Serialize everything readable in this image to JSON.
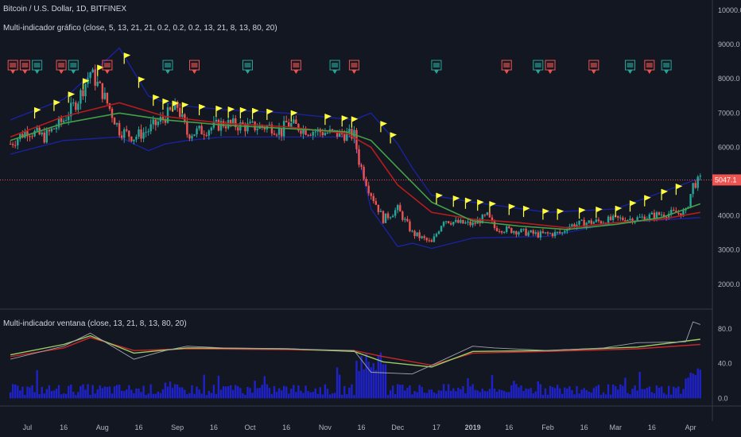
{
  "header": {
    "symbol": "Bitcoin / U.S. Dollar, 1D, BITFINEX",
    "main_indicator": "Multi-indicador gráfico (close, 5, 13, 21, 21, 0.2, 0.2, 0.2, 13, 21, 8, 13, 80, 20)",
    "sub_indicator": "Multi-indicador ventana (close, 13, 21, 8, 13, 80, 20)"
  },
  "colors": {
    "background": "#131722",
    "up": "#26a69a",
    "down": "#ef5350",
    "ma_red": "#b71c1c",
    "ma_green": "#43a047",
    "band": "#1a23a8",
    "flag": "#ffff3b",
    "price_line": "#ef5350",
    "volume": "#1e22c8",
    "osc_white": "#a0a3ab",
    "osc_green": "#9ccc65",
    "osc_red": "#c62828"
  },
  "price_label": "5047.1",
  "chart_data": {
    "type": "candlestick",
    "price_axis": {
      "ticks": [
        "10000.0",
        "9000.0",
        "8000.0",
        "7000.0",
        "6000.0",
        "5000.0",
        "4000.0",
        "3000.0",
        "2000.0"
      ],
      "tick_values": [
        10000,
        9000,
        8000,
        7000,
        6000,
        5000,
        4000,
        3000,
        2000
      ],
      "range": [
        1300,
        10300
      ]
    },
    "osc_axis": {
      "ticks": [
        "80.0",
        "40.0",
        "0.0"
      ],
      "tick_values": [
        80,
        40,
        0
      ],
      "range": [
        -8,
        100
      ]
    },
    "x_axis": {
      "labels": [
        "Jul",
        "16",
        "Aug",
        "16",
        "Sep",
        "16",
        "Oct",
        "16",
        "Nov",
        "16",
        "Dec",
        "17",
        "2019",
        "16",
        "Feb",
        "16",
        "Mar",
        "16",
        "Apr"
      ],
      "label_dates": [
        "2018-07-01",
        "2018-07-16",
        "2018-08-01",
        "2018-08-16",
        "2018-09-01",
        "2018-09-16",
        "2018-10-01",
        "2018-10-16",
        "2018-11-01",
        "2018-11-16",
        "2018-12-01",
        "2018-12-17",
        "2019-01-01",
        "2019-01-16",
        "2019-02-01",
        "2019-02-16",
        "2019-03-01",
        "2019-03-16",
        "2019-04-01"
      ]
    },
    "series": [
      {
        "name": "close",
        "dates": [
          "2018-06-24",
          "2018-07-01",
          "2018-07-08",
          "2018-07-16",
          "2018-07-22",
          "2018-07-27",
          "2018-08-01",
          "2018-08-08",
          "2018-08-14",
          "2018-08-20",
          "2018-08-27",
          "2018-09-01",
          "2018-09-05",
          "2018-09-12",
          "2018-09-20",
          "2018-09-30",
          "2018-10-10",
          "2018-10-14",
          "2018-10-16",
          "2018-10-25",
          "2018-11-05",
          "2018-11-13",
          "2018-11-15",
          "2018-11-19",
          "2018-11-21",
          "2018-11-25",
          "2018-12-01",
          "2018-12-07",
          "2018-12-15",
          "2018-12-20",
          "2018-12-25",
          "2019-01-01",
          "2019-01-07",
          "2019-01-10",
          "2019-01-20",
          "2019-01-28",
          "2019-02-07",
          "2019-02-09",
          "2019-02-17",
          "2019-02-24",
          "2019-03-01",
          "2019-03-10",
          "2019-03-20",
          "2019-03-30",
          "2019-04-02",
          "2019-04-05"
        ],
        "values": [
          6100,
          6500,
          6300,
          6800,
          7400,
          8200,
          7600,
          6500,
          6300,
          6500,
          6900,
          7200,
          6400,
          6500,
          6700,
          6600,
          6600,
          6450,
          6700,
          6500,
          6400,
          6350,
          5600,
          4800,
          4500,
          3900,
          4200,
          3500,
          3200,
          3900,
          3800,
          3750,
          4000,
          3650,
          3550,
          3450,
          3500,
          3700,
          3800,
          3850,
          3900,
          3920,
          4050,
          4100,
          4900,
          5047
        ]
      },
      {
        "name": "ma_red",
        "dates": [
          "2018-06-24",
          "2018-07-16",
          "2018-08-08",
          "2018-08-27",
          "2018-09-20",
          "2018-10-16",
          "2018-11-10",
          "2018-11-20",
          "2018-12-01",
          "2018-12-15",
          "2019-01-01",
          "2019-01-20",
          "2019-02-09",
          "2019-03-01",
          "2019-03-20",
          "2019-04-05"
        ],
        "values": [
          6300,
          6900,
          7300,
          6900,
          6700,
          6600,
          6400,
          6000,
          4900,
          4100,
          3900,
          3800,
          3650,
          3800,
          3900,
          4100
        ]
      },
      {
        "name": "ma_green",
        "dates": [
          "2018-06-24",
          "2018-07-16",
          "2018-08-08",
          "2018-08-27",
          "2018-09-20",
          "2018-10-16",
          "2018-11-10",
          "2018-11-20",
          "2018-12-01",
          "2018-12-15",
          "2019-01-01",
          "2019-01-20",
          "2019-02-09",
          "2019-03-01",
          "2019-03-20",
          "2019-04-05"
        ],
        "values": [
          6200,
          6700,
          7000,
          6800,
          6650,
          6550,
          6450,
          6200,
          5400,
          4400,
          3850,
          3700,
          3600,
          3750,
          3950,
          4350
        ]
      },
      {
        "name": "band_upper",
        "dates": [
          "2018-06-24",
          "2018-07-16",
          "2018-08-08",
          "2018-08-20",
          "2018-08-27",
          "2018-09-05",
          "2018-09-20",
          "2018-10-16",
          "2018-11-13",
          "2018-11-20",
          "2018-12-01",
          "2018-12-07",
          "2018-12-15",
          "2019-01-01",
          "2019-02-01",
          "2019-03-01",
          "2019-04-05"
        ],
        "values": [
          6800,
          7400,
          8900,
          7500,
          7300,
          7200,
          7100,
          7000,
          6800,
          7000,
          6100,
          5400,
          4600,
          4400,
          4100,
          4200,
          5100
        ]
      },
      {
        "name": "band_lower",
        "dates": [
          "2018-06-24",
          "2018-07-16",
          "2018-08-08",
          "2018-08-20",
          "2018-08-27",
          "2018-09-05",
          "2018-09-20",
          "2018-10-16",
          "2018-11-13",
          "2018-11-20",
          "2018-12-01",
          "2018-12-07",
          "2018-12-15",
          "2019-01-01",
          "2019-02-01",
          "2019-03-01",
          "2019-04-05"
        ],
        "values": [
          5800,
          6200,
          6300,
          5900,
          6100,
          6200,
          6300,
          6300,
          6300,
          4200,
          3100,
          3200,
          3050,
          3350,
          3400,
          3800,
          3950
        ]
      },
      {
        "name": "osc_white",
        "dates": [
          "2018-06-24",
          "2018-07-16",
          "2018-07-27",
          "2018-08-14",
          "2018-08-27",
          "2018-09-05",
          "2018-09-20",
          "2018-10-16",
          "2018-11-13",
          "2018-11-20",
          "2018-12-07",
          "2018-12-15",
          "2019-01-01",
          "2019-01-10",
          "2019-02-01",
          "2019-02-24",
          "2019-03-10",
          "2019-03-30",
          "2019-04-02",
          "2019-04-05"
        ],
        "values": [
          45,
          60,
          75,
          45,
          55,
          60,
          58,
          57,
          55,
          30,
          28,
          38,
          60,
          58,
          55,
          58,
          64,
          65,
          88,
          85
        ]
      },
      {
        "name": "osc_red",
        "dates": [
          "2018-06-24",
          "2018-07-16",
          "2018-07-27",
          "2018-08-14",
          "2018-09-05",
          "2018-10-16",
          "2018-11-13",
          "2018-11-25",
          "2018-12-15",
          "2019-01-01",
          "2019-02-01",
          "2019-03-10",
          "2019-04-05"
        ],
        "values": [
          48,
          58,
          70,
          55,
          57,
          56,
          55,
          48,
          38,
          52,
          54,
          57,
          62
        ]
      },
      {
        "name": "osc_green",
        "dates": [
          "2018-06-24",
          "2018-07-16",
          "2018-07-27",
          "2018-08-14",
          "2018-09-05",
          "2018-10-16",
          "2018-11-13",
          "2018-11-25",
          "2018-12-15",
          "2019-01-01",
          "2019-02-01",
          "2019-03-10",
          "2019-04-05"
        ],
        "values": [
          50,
          62,
          72,
          52,
          58,
          57,
          54,
          42,
          36,
          54,
          55,
          59,
          68
        ]
      }
    ],
    "ylim": [
      1300,
      10300
    ]
  }
}
